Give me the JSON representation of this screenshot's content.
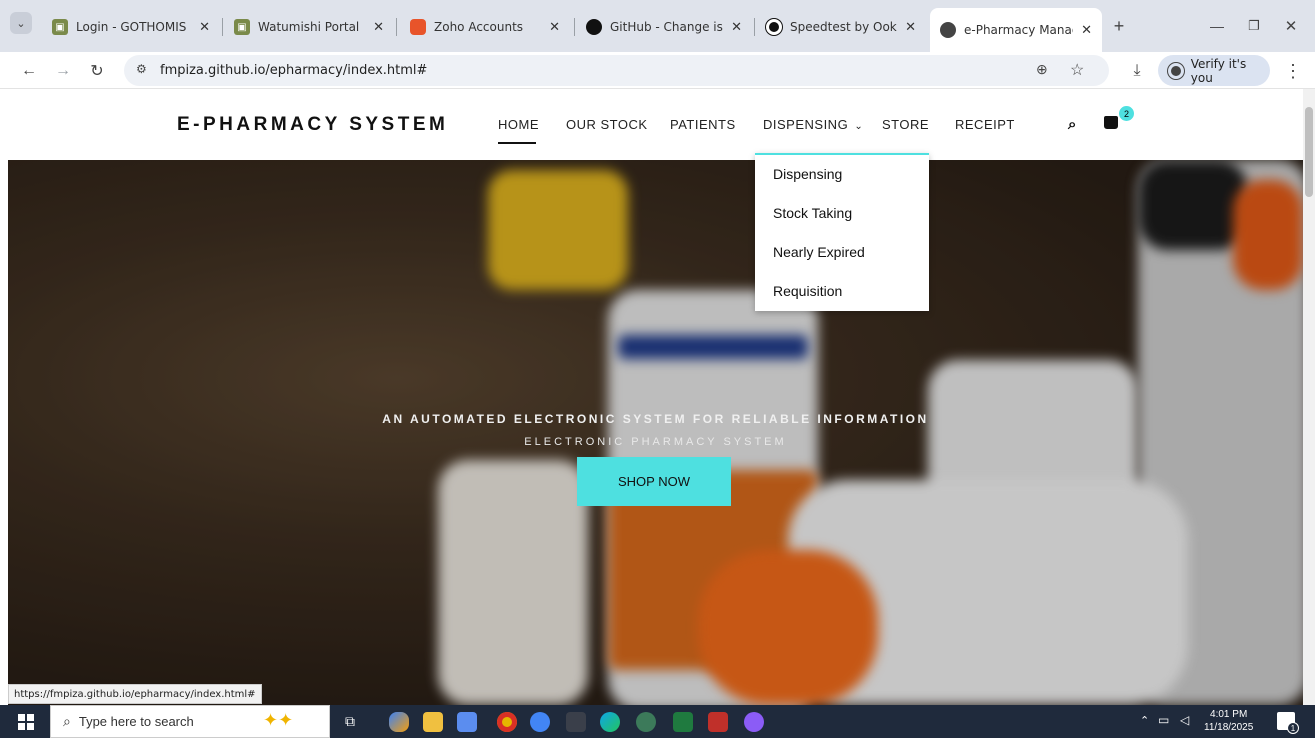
{
  "browser": {
    "tabs": [
      {
        "title": "Login - GOTHOMIS",
        "favicon_color": "#7a8a4a"
      },
      {
        "title": "Watumishi Portal",
        "favicon_color": "#7a8a4a"
      },
      {
        "title": "Zoho Accounts",
        "favicon_color": "#e8542a"
      },
      {
        "title": "GitHub - Change is co",
        "favicon_color": "#111111"
      },
      {
        "title": "Speedtest by Ookla -",
        "favicon_color": "#111111"
      },
      {
        "title": "e-Pharmacy Manage",
        "favicon_color": "#444444"
      }
    ],
    "new_tab": "+",
    "url": "fmpiza.github.io/epharmacy/index.html#",
    "verify_label": "Verify it's you",
    "status_url": "https://fmpiza.github.io/epharmacy/index.html#"
  },
  "site": {
    "brand": "E-PHARMACY SYSTEM",
    "nav": [
      "HOME",
      "OUR STOCK",
      "PATIENTS",
      "DISPENSING",
      "STORE",
      "RECEIPT"
    ],
    "dispensing_caret": "⌄",
    "cart_count": "2",
    "dropdown": [
      "Dispensing",
      "Stock Taking",
      "Nearly Expired",
      "Requisition"
    ],
    "hero": {
      "tagline": "AN AUTOMATED ELECTRONIC SYSTEM FOR RELIABLE INFORMATION",
      "subtitle": "ELECTRONIC PHARMACY SYSTEM",
      "cta": "SHOP NOW"
    }
  },
  "taskbar": {
    "search_placeholder": "Type here to search",
    "time": "4:01 PM",
    "date": "11/18/2025",
    "notification_count": "1"
  },
  "colors": {
    "accent": "#4ee0e0",
    "taskbar": "#1f2a3c"
  }
}
